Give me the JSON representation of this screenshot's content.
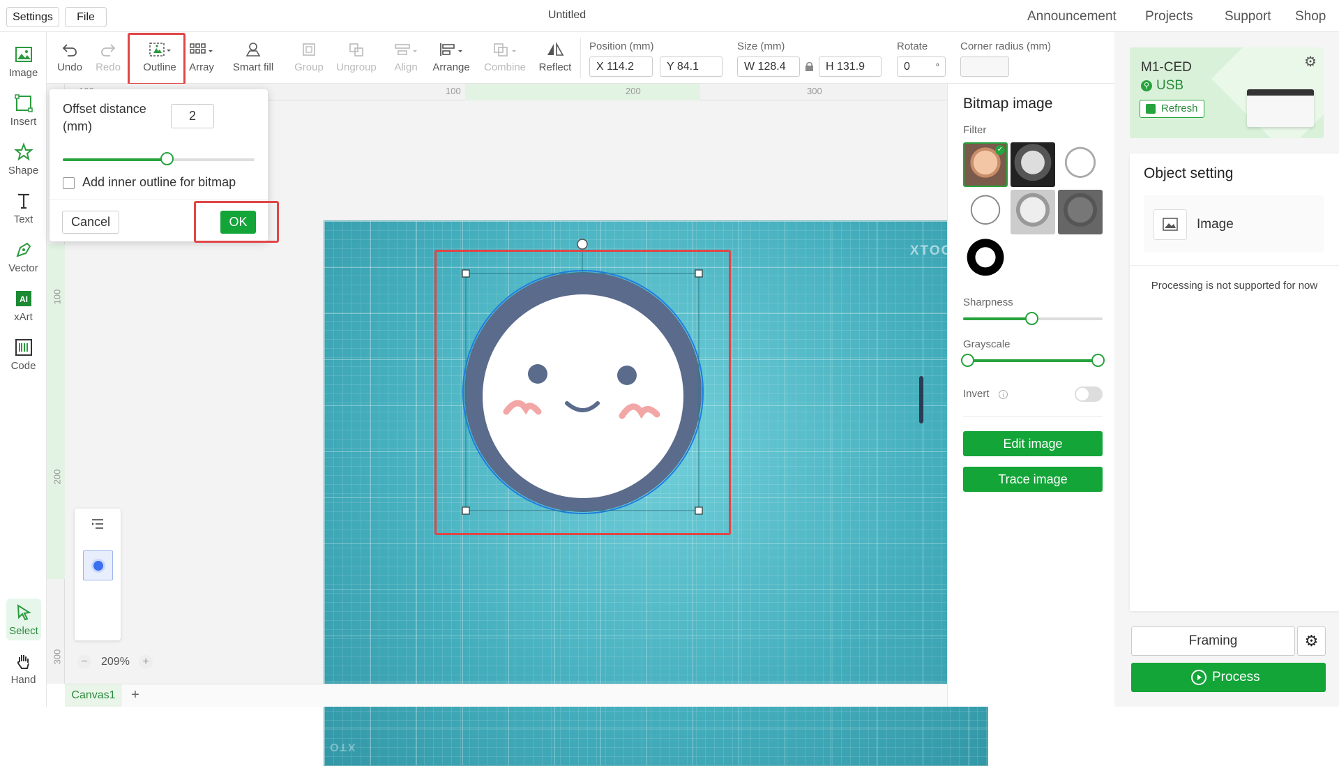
{
  "topbar": {
    "settings_label": "Settings",
    "file_label": "File",
    "title": "Untitled",
    "links": [
      "Announcement",
      "Projects",
      "Support",
      "Shop"
    ]
  },
  "left_tools": [
    "Image",
    "Insert",
    "Shape",
    "Text",
    "Vector",
    "xArt",
    "Code",
    "Select",
    "Hand"
  ],
  "toolbar": {
    "undo": "Undo",
    "redo": "Redo",
    "outline": "Outline",
    "array": "Array",
    "smart_fill": "Smart fill",
    "group": "Group",
    "ungroup": "Ungroup",
    "align": "Align",
    "arrange": "Arrange",
    "combine": "Combine",
    "reflect": "Reflect",
    "position_label": "Position (mm)",
    "x_value": "X 114.2",
    "y_value": "Y 84.1",
    "size_label": "Size (mm)",
    "w_value": "W 128.4",
    "h_value": "H 131.9",
    "rotate_label": "Rotate",
    "rotate_value": "0",
    "rotate_unit": "°",
    "corner_label": "Corner radius (mm)",
    "corner_value": ""
  },
  "rulers": {
    "top_ticks": [
      "100",
      "100",
      "200",
      "300"
    ],
    "left_ticks": [
      "100",
      "200",
      "300"
    ]
  },
  "mat": {
    "brand_top": "XTOOL",
    "brand_bottom": "XTO"
  },
  "outline_dialog": {
    "offset_label": "Offset distance (mm)",
    "offset_value": "2",
    "offset_slider_fraction": 0.54,
    "inner_outline_label": "Add inner outline for bitmap",
    "inner_outline_checked": false,
    "cancel_label": "Cancel",
    "ok_label": "OK"
  },
  "layer_panel": {
    "zoom": "209%",
    "zoom_minus": "−",
    "zoom_plus": "+"
  },
  "tabs": {
    "canvas_tab": "Canvas1",
    "add_tab": "+"
  },
  "bitmap_panel": {
    "title": "Bitmap image",
    "filter_label": "Filter",
    "filters_count": 7,
    "sharpness_label": "Sharpness",
    "sharpness_fraction": 0.49,
    "grayscale_label": "Grayscale",
    "grayscale_range": [
      0,
      1
    ],
    "invert_label": "Invert",
    "invert_on": false,
    "edit_image_label": "Edit image",
    "trace_image_label": "Trace image"
  },
  "device": {
    "name": "M1-CED",
    "connection": "USB",
    "refresh_label": "Refresh"
  },
  "object_setting": {
    "title": "Object setting",
    "object_type": "Image",
    "message": "Processing is not supported for now"
  },
  "actions": {
    "framing_label": "Framing",
    "process_label": "Process"
  },
  "colors": {
    "accent": "#13a538",
    "highlight_red": "#e04646",
    "mat": "#4ab6c4"
  }
}
